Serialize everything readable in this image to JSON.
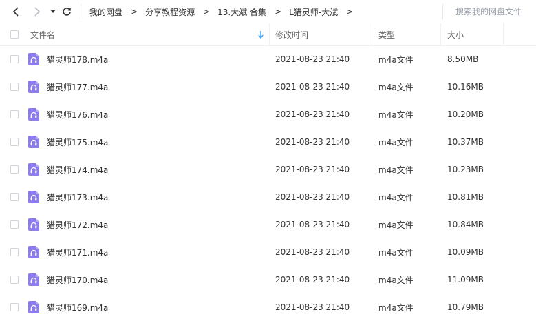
{
  "breadcrumb": {
    "items": [
      "我的网盘",
      "分享教程资源",
      "13.大斌 合集",
      "L猎灵师-大斌"
    ],
    "separator": ">"
  },
  "search": {
    "placeholder": "搜索我的网盘文件"
  },
  "columns": {
    "name": "文件名",
    "modified": "修改时间",
    "type": "类型",
    "size": "大小"
  },
  "sort": {
    "column": "name",
    "direction": "down",
    "indicator_color": "#2f9bf4"
  },
  "colors": {
    "icon_bg": "#8c7cf0",
    "accent": "#2f9bf4",
    "border": "#e6e8ec"
  },
  "files": [
    {
      "name": "猎灵师178.m4a",
      "modified": "2021-08-23 21:40",
      "type": "m4a文件",
      "size": "8.50MB"
    },
    {
      "name": "猎灵师177.m4a",
      "modified": "2021-08-23 21:40",
      "type": "m4a文件",
      "size": "10.16MB"
    },
    {
      "name": "猎灵师176.m4a",
      "modified": "2021-08-23 21:40",
      "type": "m4a文件",
      "size": "10.20MB"
    },
    {
      "name": "猎灵师175.m4a",
      "modified": "2021-08-23 21:40",
      "type": "m4a文件",
      "size": "10.37MB"
    },
    {
      "name": "猎灵师174.m4a",
      "modified": "2021-08-23 21:40",
      "type": "m4a文件",
      "size": "10.23MB"
    },
    {
      "name": "猎灵师173.m4a",
      "modified": "2021-08-23 21:40",
      "type": "m4a文件",
      "size": "10.81MB"
    },
    {
      "name": "猎灵师172.m4a",
      "modified": "2021-08-23 21:40",
      "type": "m4a文件",
      "size": "10.84MB"
    },
    {
      "name": "猎灵师171.m4a",
      "modified": "2021-08-23 21:40",
      "type": "m4a文件",
      "size": "10.09MB"
    },
    {
      "name": "猎灵师170.m4a",
      "modified": "2021-08-23 21:40",
      "type": "m4a文件",
      "size": "11.09MB"
    },
    {
      "name": "猎灵师169.m4a",
      "modified": "2021-08-23 21:40",
      "type": "m4a文件",
      "size": "10.79MB"
    }
  ]
}
